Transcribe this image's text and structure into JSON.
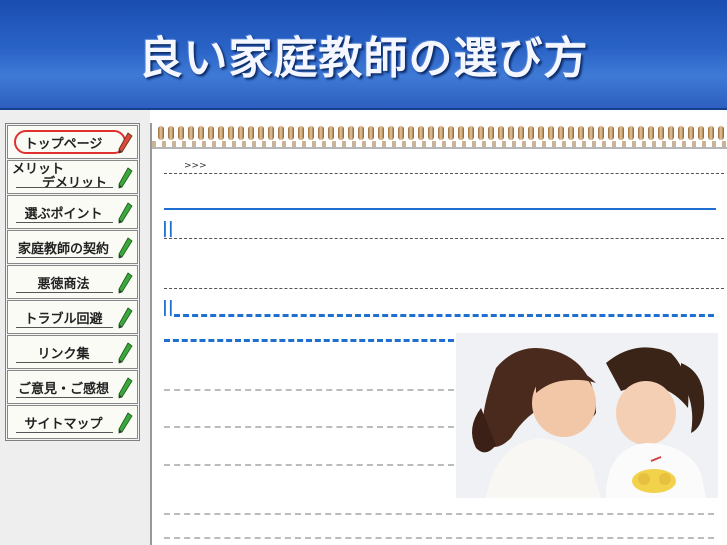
{
  "header": {
    "title": "良い家庭教師の選び方"
  },
  "nav": {
    "items": [
      {
        "label": "トップページ",
        "active": true
      },
      {
        "label_line1": "メリット",
        "label_line2": "デメリット"
      },
      {
        "label": "選ぶポイント"
      },
      {
        "label": "家庭教師の契約"
      },
      {
        "label": "悪徳商法"
      },
      {
        "label": "トラブル回避"
      },
      {
        "label": "リンク集"
      },
      {
        "label": "ご意見・ご感想"
      },
      {
        "label": "サイトマップ"
      }
    ]
  },
  "content": {
    "breadcrumb": ">>>",
    "section_marker_1": "||",
    "section_marker_2": "||"
  },
  "colors": {
    "banner": "#2a63c6",
    "accent_blue": "#1e6fd0",
    "active_oval": "#e03030",
    "pencil": "#2e9a2e"
  },
  "icons": {
    "nav_pencil": "pencil-icon"
  }
}
